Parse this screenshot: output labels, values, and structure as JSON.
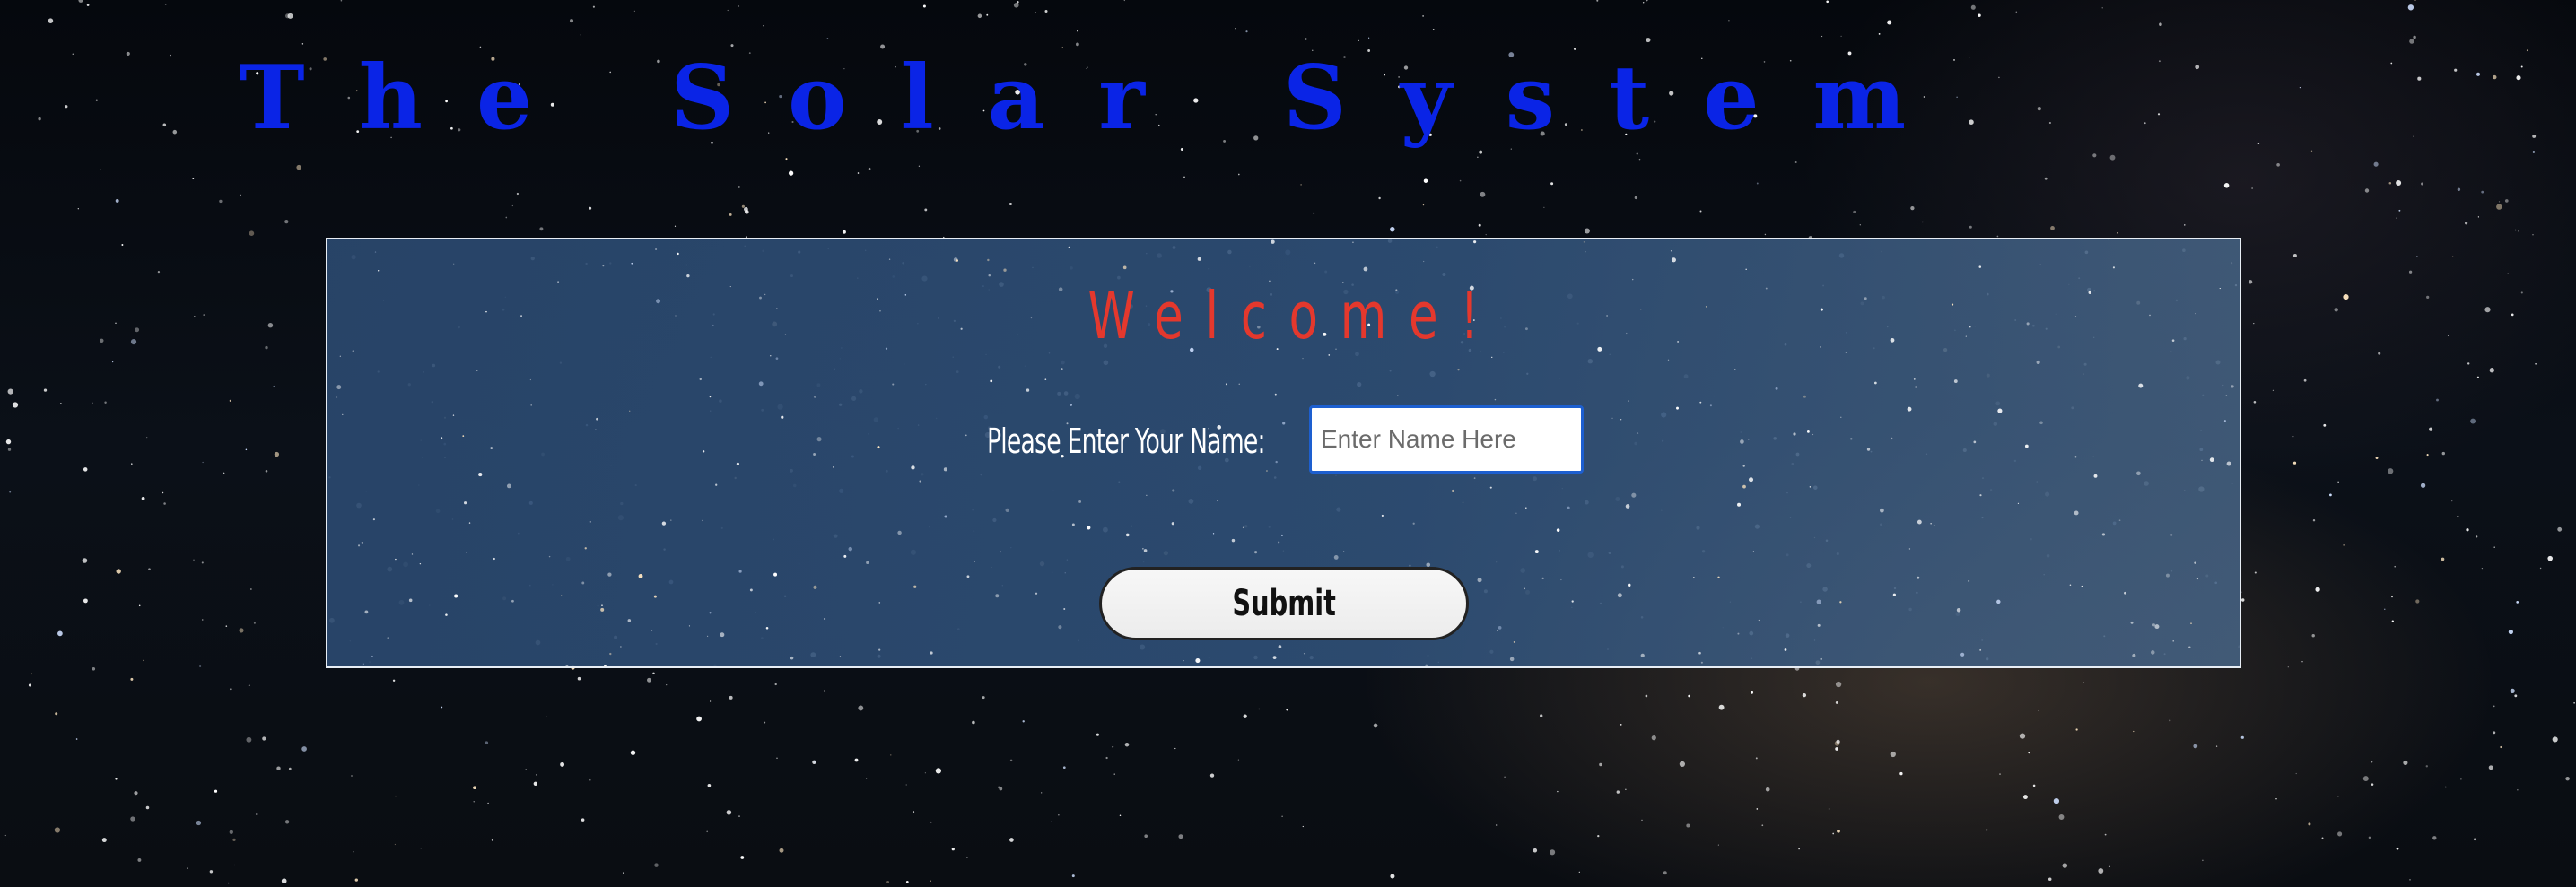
{
  "page": {
    "title": "The Solar System",
    "background_icon": "starfield-background"
  },
  "form": {
    "heading": "Welcome!",
    "name_label": "Please Enter Your Name:",
    "name_input": {
      "value": "",
      "placeholder": "Enter Name Here"
    },
    "submit_label": "Submit"
  },
  "colors": {
    "title": "#0a24e6",
    "heading": "#e4382d",
    "panel": "#2f5078",
    "input_border": "#1d5fd0"
  }
}
